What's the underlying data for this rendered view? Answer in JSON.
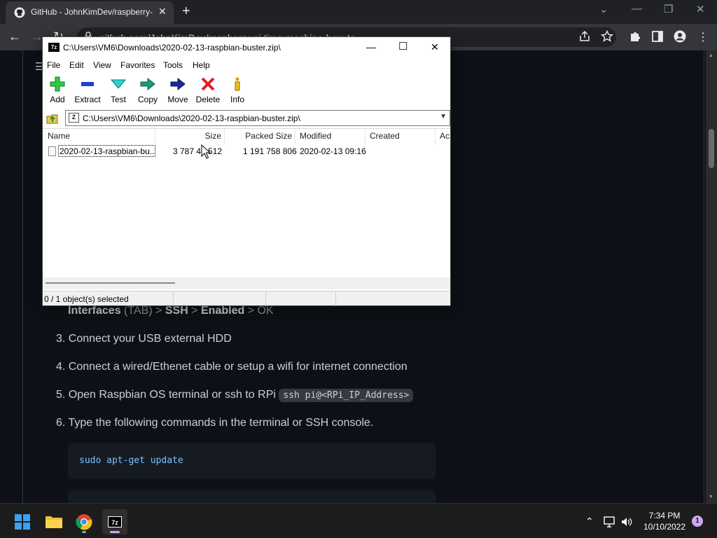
{
  "browser": {
    "tab_title": "GitHub - JohnKimDev/raspberry-",
    "url": "github.com/JohnKimDev/raspberry-pi-time-machine-how-to"
  },
  "page": {
    "line_interfaces": {
      "a": "Interfaces",
      "b": " (TAB) > ",
      "c": "SSH",
      "d": " > ",
      "e": "Enabled",
      "f": " > OK"
    },
    "item3": "3. Connect your USB external HDD",
    "item4": "4. Connect a wired/Ethenet cable or setup a wifi for internet connection",
    "item5_text": "5. Open Raspbian OS terminal or ssh to RPi",
    "item5_code": "ssh pi@<RPi_IP_Address>",
    "item6": "6. Type the following commands in the terminal or SSH console.",
    "code1": "sudo apt-get update"
  },
  "zip": {
    "app_icon": "7z",
    "title": "C:\\Users\\VM6\\Downloads\\2020-02-13-raspbian-buster.zip\\",
    "menu": [
      "File",
      "Edit",
      "View",
      "Favorites",
      "Tools",
      "Help"
    ],
    "toolbar": [
      "Add",
      "Extract",
      "Test",
      "Copy",
      "Move",
      "Delete",
      "Info"
    ],
    "address": "C:\\Users\\VM6\\Downloads\\2020-02-13-raspbian-buster.zip\\",
    "columns": [
      "Name",
      "Size",
      "Packed Size",
      "Modified",
      "Created",
      "Ac"
    ],
    "rows": [
      {
        "name": "2020-02-13-raspbian-bu...",
        "size": "3 787 45  512",
        "packed": "1 191 758 806",
        "modified": "2020-02-13 09:16",
        "created": ""
      }
    ],
    "status": "0 / 1 object(s) selected"
  },
  "taskbar": {
    "app_7z": "7z",
    "time": "7:34 PM",
    "date": "10/10/2022",
    "notifications": "1"
  }
}
